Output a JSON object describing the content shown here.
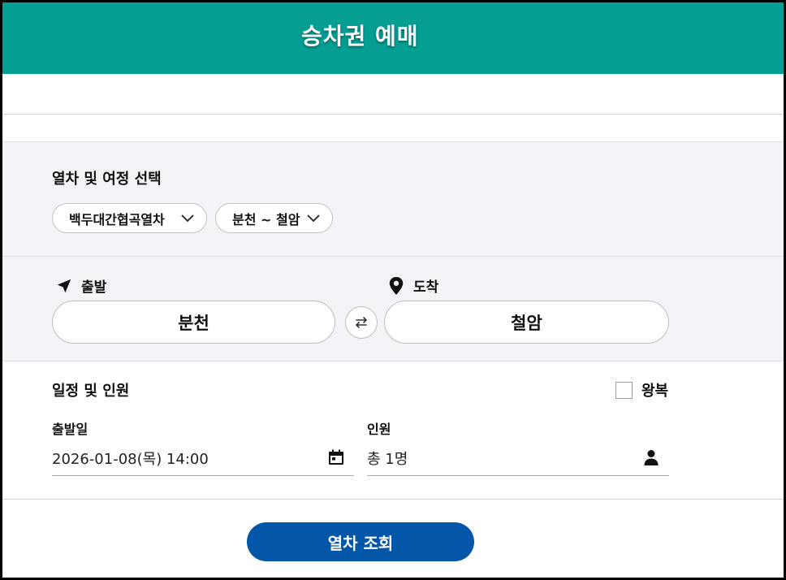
{
  "header": {
    "title": "승차권 예매"
  },
  "route_section": {
    "title": "열차 및 여정 선택",
    "train_select": {
      "value": "백두대간협곡열차",
      "icon": "chevron-down-icon"
    },
    "route_select": {
      "value": "분천 ~ 철암",
      "icon": "chevron-down-icon"
    }
  },
  "station_section": {
    "departure": {
      "label": "출발",
      "icon": "navigation-arrow-icon",
      "value": "분천"
    },
    "swap_icon": "swap-arrows-icon",
    "arrival": {
      "label": "도착",
      "icon": "map-pin-icon",
      "value": "철암"
    }
  },
  "schedule_section": {
    "title": "일정 및 인원",
    "round_trip": {
      "label": "왕복",
      "checked": false
    },
    "departure_date": {
      "label": "출발일",
      "value": "2026-01-08(목) 14:00",
      "icon": "calendar-icon"
    },
    "passengers": {
      "label": "인원",
      "value": "총 1명",
      "icon": "person-icon"
    }
  },
  "search_button": {
    "label": "열차 조회"
  },
  "colors": {
    "header": "#049e93",
    "button": "#0456a8",
    "section_bg": "#f3f4f7"
  }
}
